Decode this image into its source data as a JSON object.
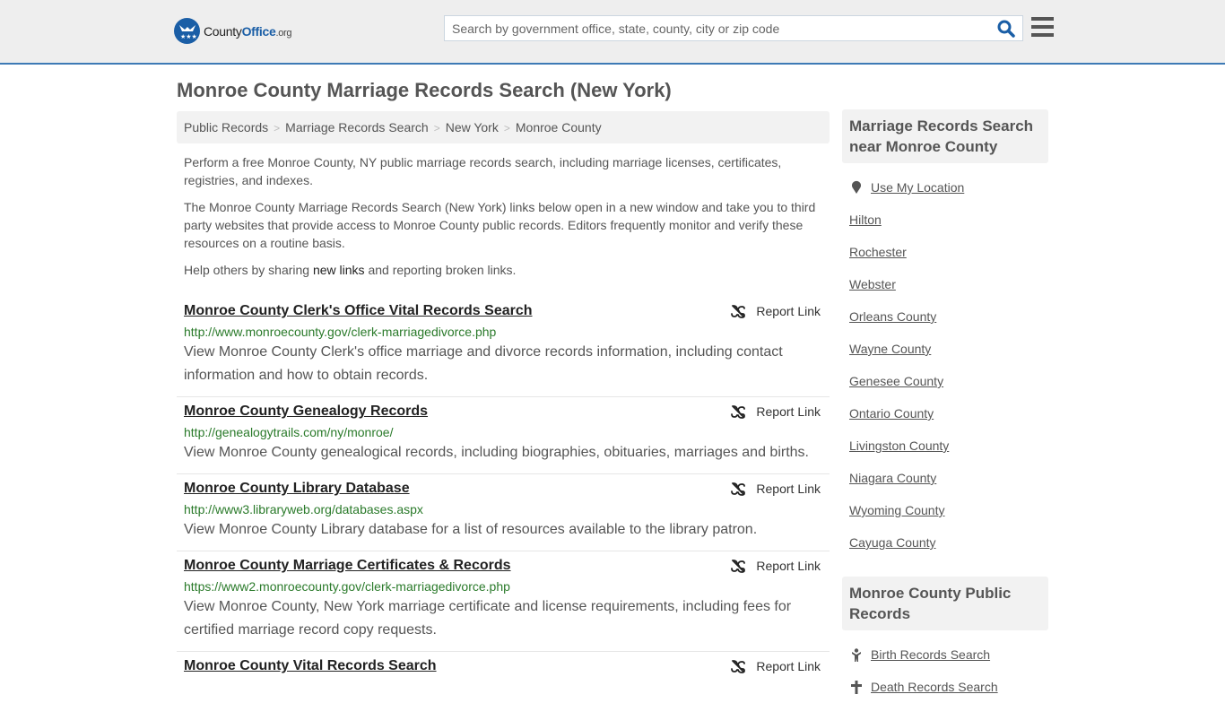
{
  "header": {
    "logo": {
      "name": "County",
      "name_bold": "Office",
      "tld": ".org"
    },
    "search": {
      "placeholder": "Search by government office, state, county, city or zip code",
      "value": ""
    },
    "colors": {
      "brand_blue": "#1a5ea6",
      "header_bg": "#eeeeee",
      "accent_line": "#3d7ab5"
    }
  },
  "page": {
    "title": "Monroe County Marriage Records Search (New York)",
    "breadcrumb": [
      "Public Records",
      "Marriage Records Search",
      "New York",
      "Monroe County"
    ],
    "intro": {
      "p1": "Perform a free Monroe County, NY public marriage records search, including marriage licenses, certificates, registries, and indexes.",
      "p2": "The Monroe County Marriage Records Search (New York) links below open in a new window and take you to third party websites that provide access to Monroe County public records. Editors frequently monitor and verify these resources on a routine basis.",
      "p3_before": "Help others by sharing ",
      "p3_link": "new links",
      "p3_after": " and reporting broken links."
    },
    "report_label": "Report Link",
    "links": [
      {
        "title": "Monroe County Clerk's Office Vital Records Search",
        "url": "http://www.monroecounty.gov/clerk-marriagedivorce.php",
        "desc": "View Monroe County Clerk's office marriage and divorce records information, including contact information and how to obtain records."
      },
      {
        "title": "Monroe County Genealogy Records",
        "url": "http://genealogytrails.com/ny/monroe/",
        "desc": "View Monroe County genealogical records, including biographies, obituaries, marriages and births."
      },
      {
        "title": "Monroe County Library Database",
        "url": "http://www3.libraryweb.org/databases.aspx",
        "desc": "View Monroe County Library database for a list of resources available to the library patron."
      },
      {
        "title": "Monroe County Marriage Certificates & Records",
        "url": "https://www2.monroecounty.gov/clerk-marriagedivorce.php",
        "desc": "View Monroe County, New York marriage certificate and license requirements, including fees for certified marriage record copy requests."
      },
      {
        "title": "Monroe County Vital Records Search",
        "url": "",
        "desc": ""
      }
    ]
  },
  "sidebar": {
    "nearby_heading": "Marriage Records Search near Monroe County",
    "use_location": "Use My Location",
    "nearby": [
      "Hilton",
      "Rochester",
      "Webster",
      "Orleans County",
      "Wayne County",
      "Genesee County",
      "Ontario County",
      "Livingston County",
      "Niagara County",
      "Wyoming County",
      "Cayuga County"
    ],
    "public_heading": "Monroe County Public Records",
    "public_links": [
      {
        "label": "Birth Records Search",
        "icon": "baby-icon"
      },
      {
        "label": "Death Records Search",
        "icon": "cross-icon"
      }
    ]
  }
}
